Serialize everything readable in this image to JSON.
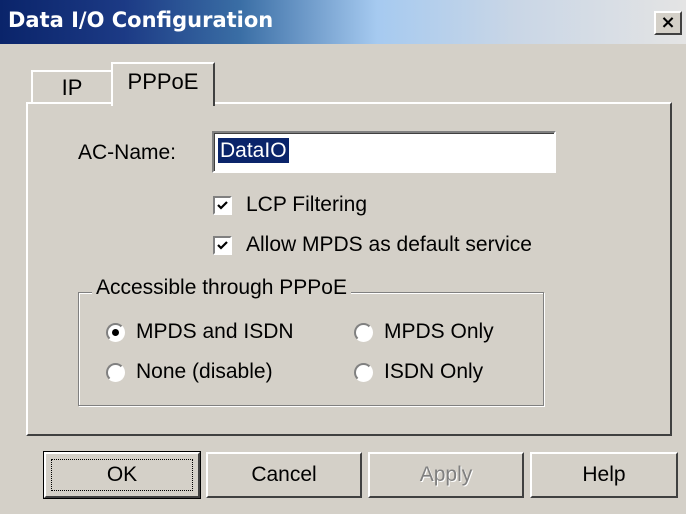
{
  "window": {
    "title": "Data I/O Configuration",
    "close_label": "×"
  },
  "tabs": [
    {
      "label": "IP",
      "selected": false
    },
    {
      "label": "PPPoE",
      "selected": true
    }
  ],
  "form": {
    "ac_name_label": "AC-Name:",
    "ac_name_value": "DataIO",
    "lcp_filtering": {
      "label": "LCP Filtering",
      "checked": true
    },
    "allow_mpds": {
      "label": "Allow MPDS as default service",
      "checked": true
    }
  },
  "group": {
    "legend": "Accessible through PPPoE",
    "options": [
      {
        "label": "MPDS and ISDN",
        "selected": true
      },
      {
        "label": "MPDS Only",
        "selected": false
      },
      {
        "label": "None (disable)",
        "selected": false
      },
      {
        "label": "ISDN Only",
        "selected": false
      }
    ]
  },
  "buttons": {
    "ok": "OK",
    "cancel": "Cancel",
    "apply": "Apply",
    "help": "Help"
  },
  "colors": {
    "face": "#d4d0c8",
    "title_active": "#0a246a",
    "selection": "#0a246a",
    "disabled_text": "#808080"
  }
}
